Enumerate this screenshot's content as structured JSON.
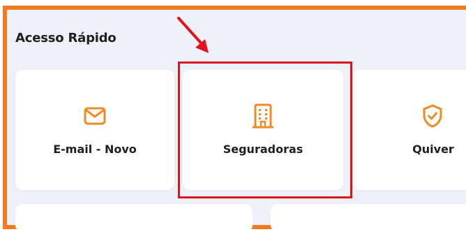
{
  "section": {
    "title": "Acesso Rápido"
  },
  "cards": {
    "email": {
      "label": "E-mail - Novo",
      "icon": "mail-icon"
    },
    "seguradoras": {
      "label": "Seguradoras",
      "icon": "building-icon"
    },
    "quiver": {
      "label": "Quiver",
      "icon": "shield-check-icon"
    }
  },
  "colors": {
    "frame_border": "#f37a1f",
    "icon_accent": "#f08a24",
    "annotation_red": "#e0141b",
    "background": "#eef1f8",
    "card": "#ffffff"
  }
}
